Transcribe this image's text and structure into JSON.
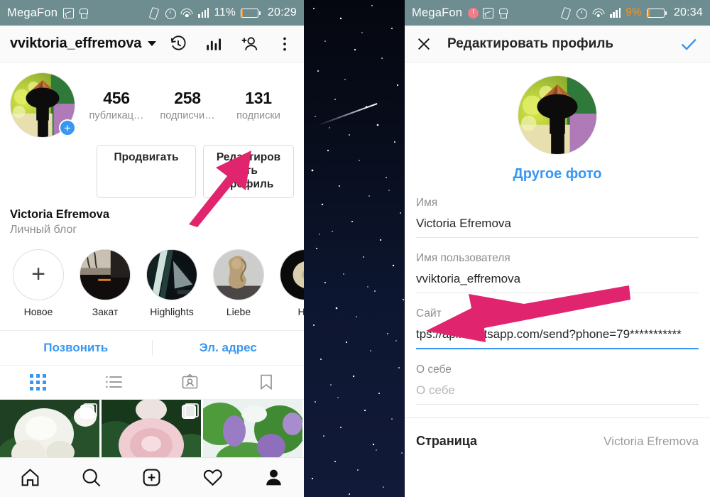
{
  "left": {
    "statusbar": {
      "carrier": "MegaFon",
      "icons": [
        "screenshot-icon",
        "brush-icon",
        "vibrate-icon",
        "alarm-icon",
        "wifi-icon",
        "signal-icon"
      ],
      "battery_percent": "11%",
      "time": "20:29"
    },
    "header": {
      "username": "vviktoria_effremova",
      "icons": [
        "history-icon",
        "stats-icon",
        "add-person-icon",
        "more-icon"
      ]
    },
    "stats": [
      {
        "num": "456",
        "label": "публикац…"
      },
      {
        "num": "258",
        "label": "подписчи…"
      },
      {
        "num": "131",
        "label": "подписки"
      }
    ],
    "buttons": {
      "promote": "Продвигать",
      "edit": "Редактиров ать профиль"
    },
    "bio": {
      "name": "Victoria Efremova",
      "category": "Личный блог"
    },
    "highlights": [
      {
        "label": "Новое",
        "type": "new"
      },
      {
        "label": "Закат",
        "type": "image"
      },
      {
        "label": "Highlights",
        "type": "image"
      },
      {
        "label": "Liebe",
        "type": "image"
      },
      {
        "label": "Hig",
        "type": "image"
      }
    ],
    "contact": {
      "call": "Позвонить",
      "email": "Эл. адрес"
    },
    "tabs": [
      "grid-icon",
      "list-icon",
      "tagged-icon",
      "saved-icon"
    ],
    "photos": [
      "white-peony",
      "pink-peony",
      "lilac-bush"
    ],
    "bottom_nav": [
      "home-icon",
      "search-icon",
      "add-post-icon",
      "heart-icon",
      "profile-icon"
    ]
  },
  "right": {
    "statusbar": {
      "carrier": "MegaFon",
      "icons": [
        "sim-icon",
        "screenshot-icon",
        "brush-icon",
        "vibrate-icon",
        "alarm-icon",
        "wifi-icon",
        "signal-icon"
      ],
      "battery_percent": "9%",
      "time": "20:34"
    },
    "header": {
      "title": "Редактировать профиль",
      "close": "close-icon",
      "confirm": "check-icon"
    },
    "change_photo": "Другое фото",
    "fields": [
      {
        "label": "Имя",
        "value": "Victoria Efremova",
        "active": false,
        "placeholder": false
      },
      {
        "label": "Имя пользователя",
        "value": "vviktoria_effremova",
        "active": false,
        "placeholder": false
      },
      {
        "label": "Сайт",
        "value": "tps://api.whatsapp.com/send?phone=79***********",
        "active": true,
        "placeholder": false
      },
      {
        "label": "О себе",
        "value": "О себе",
        "active": false,
        "placeholder": true
      }
    ],
    "page_row": {
      "label": "Страница",
      "value": "Victoria Efremova"
    }
  },
  "annotations": {
    "arrow_color": "#e1246e",
    "arrow_left_target": "Редактировать профиль",
    "arrow_right_target": "Сайт"
  }
}
